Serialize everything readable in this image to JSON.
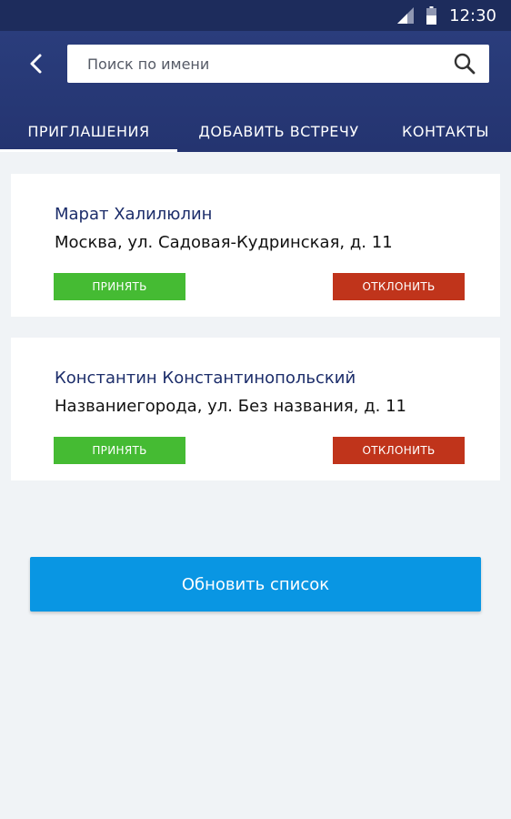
{
  "status_bar": {
    "time": "12:30",
    "icons": [
      "signal-icon",
      "battery-icon"
    ]
  },
  "header": {
    "back_icon": "chevron-left-icon",
    "search": {
      "placeholder": "Поиск по имени",
      "value": "",
      "icon": "search-icon"
    }
  },
  "tabs": [
    {
      "label": "ПРИГЛАШЕНИЯ",
      "active": true
    },
    {
      "label": "ДОБАВИТЬ ВСТРЕЧУ",
      "active": false
    },
    {
      "label": "КОНТАКТЫ",
      "active": false
    }
  ],
  "invitations": [
    {
      "name": "Марат Халилюлин",
      "address": "Москва, ул. Садовая-Кудринская, д. 11",
      "accept_label": "ПРИНЯТЬ",
      "decline_label": "ОТКЛОНИТЬ"
    },
    {
      "name": "Константин Константинопольский",
      "address": "Названиегорода, ул. Без названия, д. 11",
      "accept_label": "ПРИНЯТЬ",
      "decline_label": "ОТКЛОНИТЬ"
    }
  ],
  "refresh_button": {
    "label": "Обновить список"
  },
  "colors": {
    "header_bg": "#243470",
    "status_bar_bg": "#1d2c5c",
    "accept": "#45bb33",
    "decline": "#c0341b",
    "primary_button": "#0996e3",
    "name_text": "#1c2d6a",
    "page_bg": "#f0f3f6"
  }
}
